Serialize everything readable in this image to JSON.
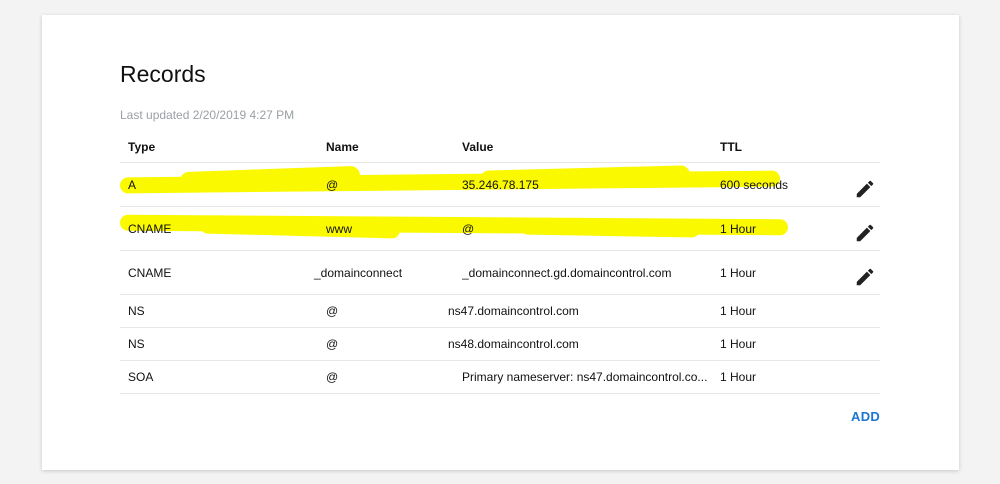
{
  "page": {
    "title": "Records",
    "last_updated": "Last updated 2/20/2019 4:27 PM"
  },
  "table": {
    "headers": {
      "type": "Type",
      "name": "Name",
      "value": "Value",
      "ttl": "TTL"
    },
    "rows": [
      {
        "type": "A",
        "name": "@",
        "value": "35.246.78.175",
        "ttl": "600 seconds",
        "editable": true,
        "highlighted": true
      },
      {
        "type": "CNAME",
        "name": "www",
        "value": "@",
        "ttl": "1 Hour",
        "editable": true,
        "highlighted": true
      },
      {
        "type": "CNAME",
        "name": "_domainconnect",
        "value": "_domainconnect.gd.domaincontrol.com",
        "ttl": "1 Hour",
        "editable": true,
        "highlighted": false
      },
      {
        "type": "NS",
        "name": "@",
        "value": "ns47.domaincontrol.com",
        "ttl": "1 Hour",
        "editable": false,
        "highlighted": false
      },
      {
        "type": "NS",
        "name": "@",
        "value": "ns48.domaincontrol.com",
        "ttl": "1 Hour",
        "editable": false,
        "highlighted": false
      },
      {
        "type": "SOA",
        "name": "@",
        "value": "Primary nameserver: ns47.domaincontrol.co...",
        "ttl": "1 Hour",
        "editable": false,
        "highlighted": false
      }
    ]
  },
  "actions": {
    "add_label": "ADD"
  },
  "colors": {
    "accent": "#1976d2",
    "highlight": "#fbf900",
    "muted": "#9aa0a6"
  },
  "icons": {
    "edit": "pencil-icon"
  }
}
